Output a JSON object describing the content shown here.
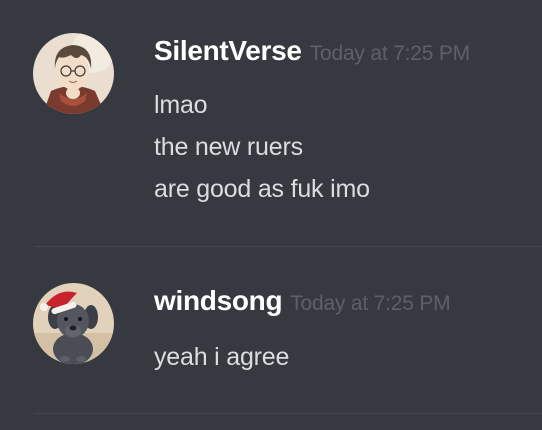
{
  "messages": [
    {
      "username": "SilentVerse",
      "timestamp": "Today at 7:25 PM",
      "avatar_icon": "anime-character-avatar",
      "lines": [
        "lmao",
        "the new ruers",
        "are good as fuk imo"
      ]
    },
    {
      "username": "windsong",
      "timestamp": "Today at 7:25 PM",
      "avatar_icon": "dog-santa-hat-avatar",
      "lines": [
        "yeah i agree"
      ]
    }
  ],
  "colors": {
    "background": "#36393f",
    "username": "#ffffff",
    "timestamp": "#5d6167",
    "message_text": "#dcddde",
    "divider": "#43464c"
  }
}
